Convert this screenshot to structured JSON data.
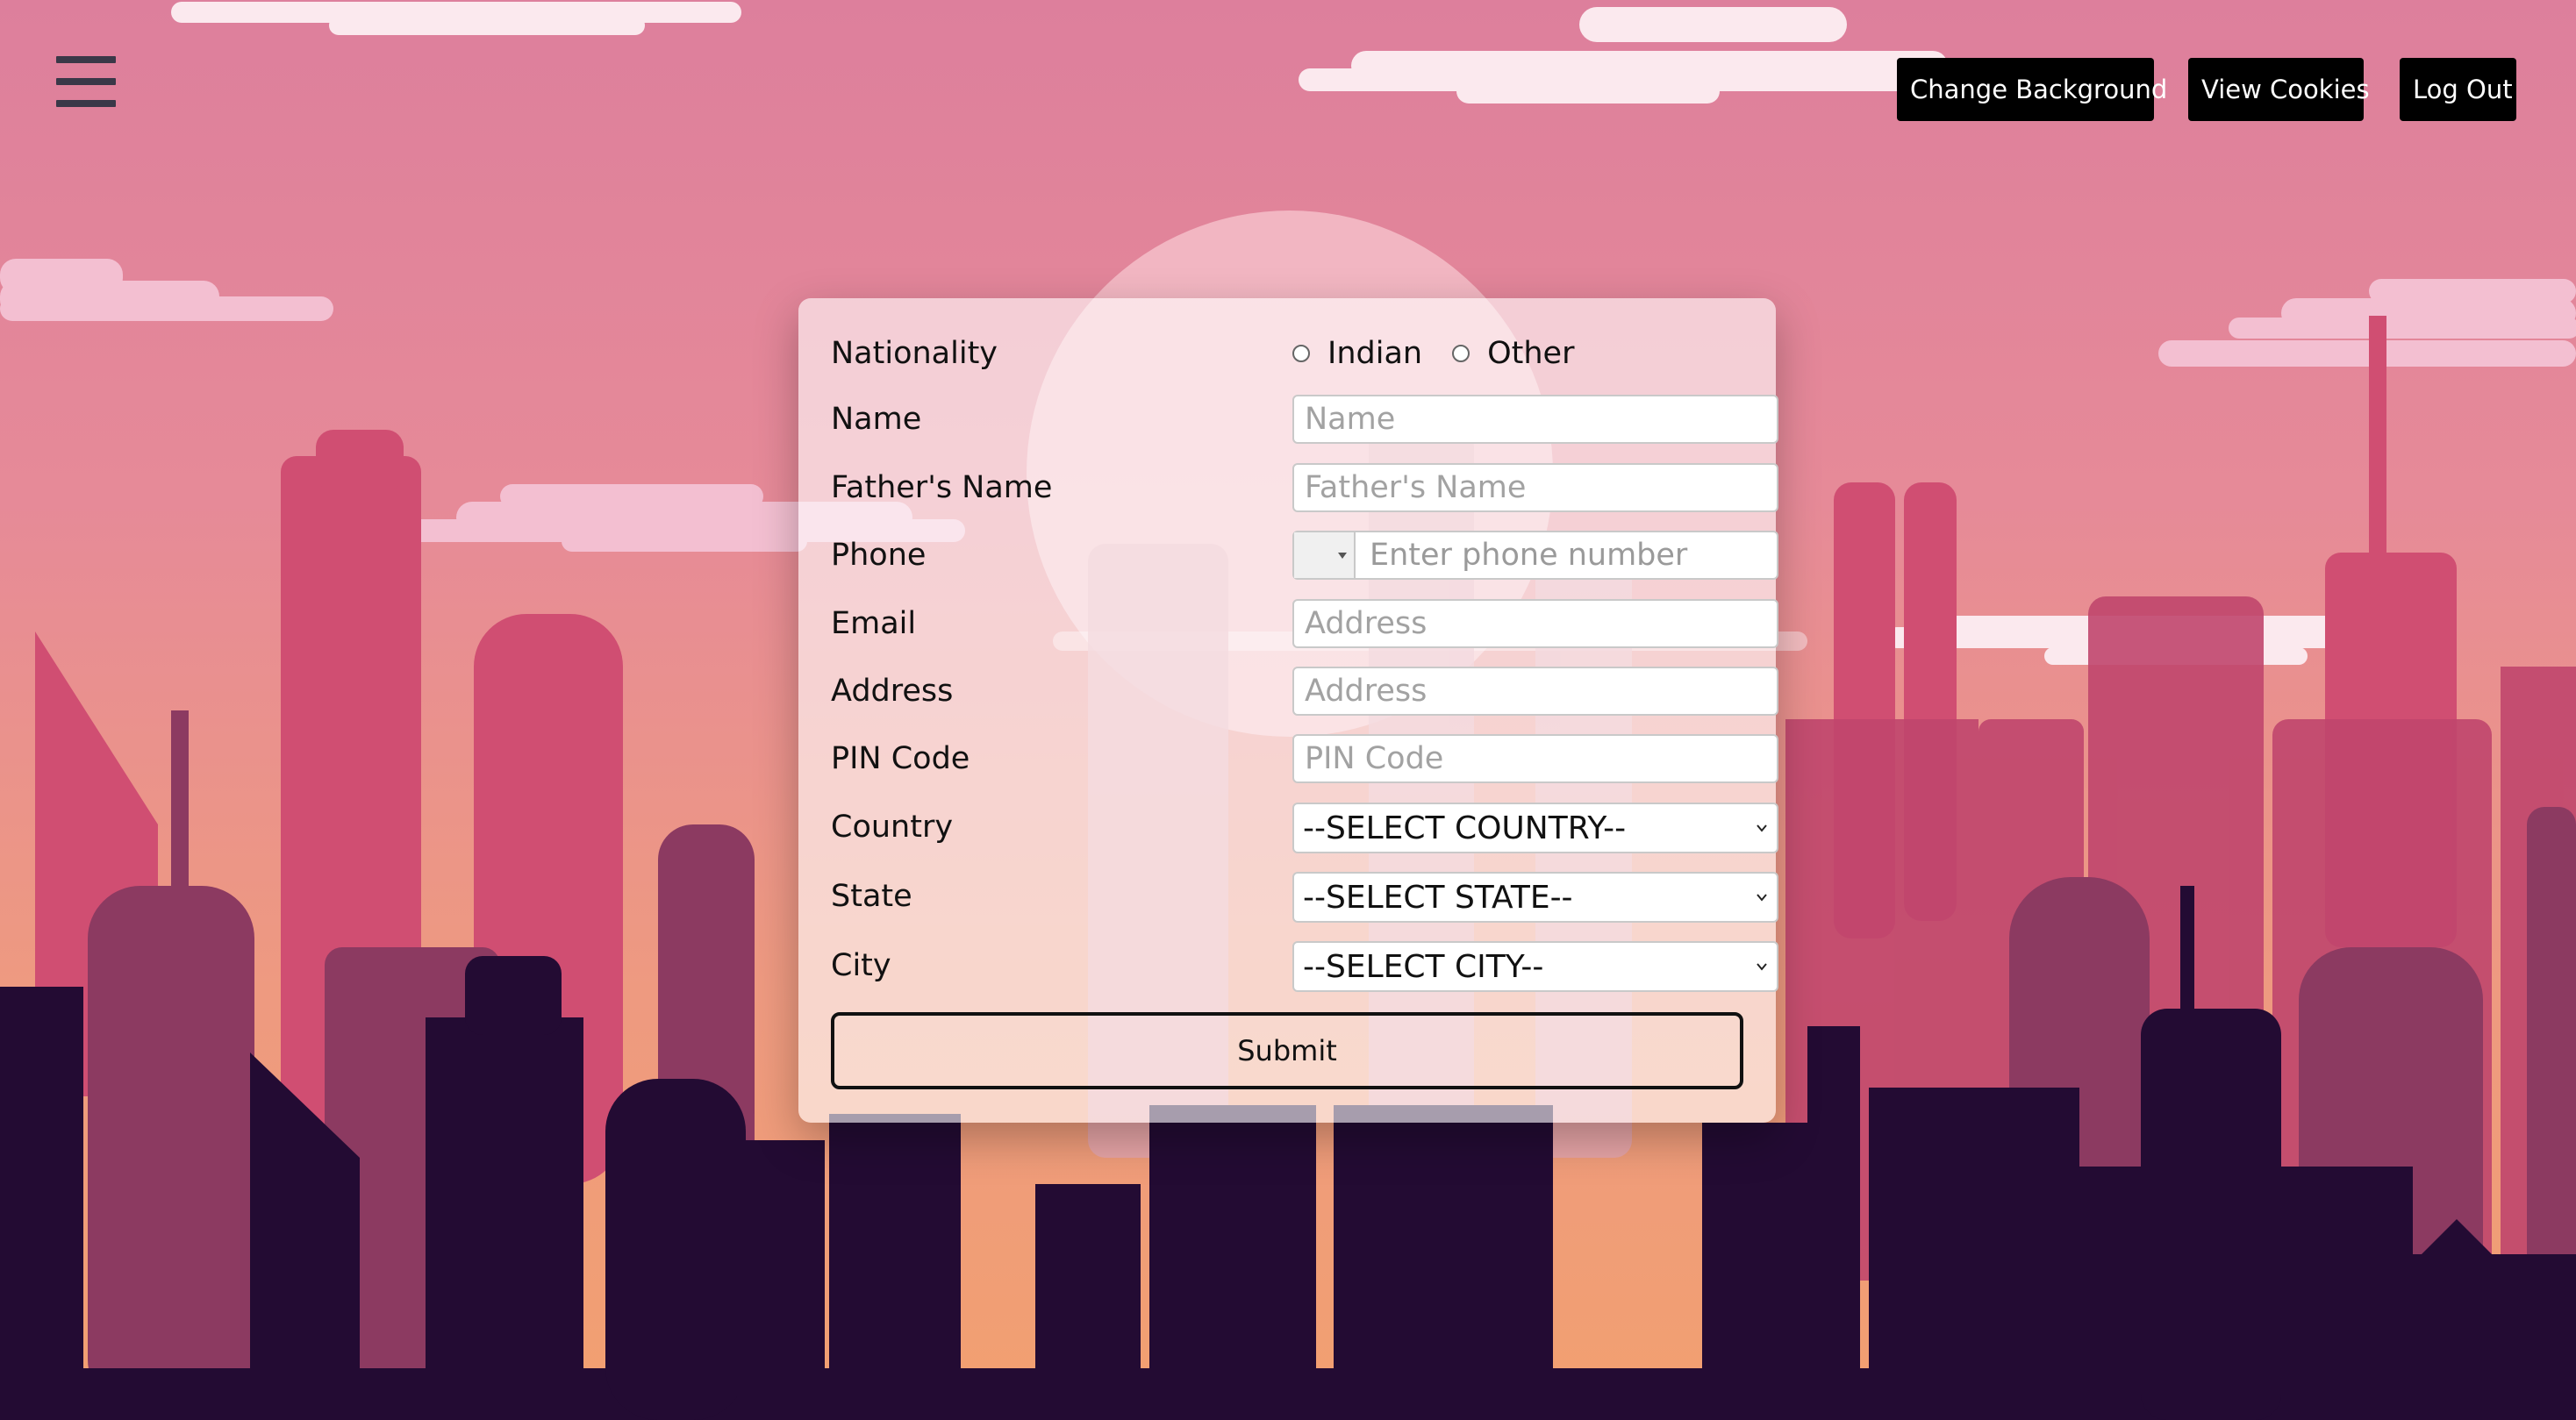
{
  "header": {
    "change_background": "Change Background",
    "view_cookies": "View Cookies",
    "log_out": "Log Out"
  },
  "form": {
    "nationality": {
      "label": "Nationality",
      "options": [
        "Indian",
        "Other"
      ]
    },
    "name": {
      "label": "Name",
      "placeholder": "Name"
    },
    "father_name": {
      "label": "Father's Name",
      "placeholder": "Father's Name"
    },
    "phone": {
      "label": "Phone",
      "placeholder": "Enter phone number"
    },
    "email": {
      "label": "Email",
      "placeholder": "Address"
    },
    "address": {
      "label": "Address",
      "placeholder": "Address"
    },
    "pin_code": {
      "label": "PIN Code",
      "placeholder": "PIN Code"
    },
    "country": {
      "label": "Country",
      "selected": "--SELECT COUNTRY--"
    },
    "state": {
      "label": "State",
      "selected": "--SELECT STATE--"
    },
    "city": {
      "label": "City",
      "selected": "--SELECT CITY--"
    },
    "submit": "Submit"
  },
  "colors": {
    "sky_top": "#dd7d9b",
    "sky_bottom": "#f0a078",
    "skyline_dark": "#230b33",
    "button_bg": "#000000"
  },
  "icons": {
    "menu": "hamburger-icon",
    "select_arrow": "chevron-down-icon",
    "phone_country": "caret-down-icon"
  }
}
